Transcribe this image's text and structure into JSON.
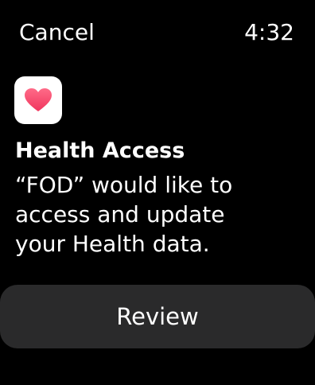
{
  "header": {
    "cancel_label": "Cancel",
    "time": "4:32"
  },
  "icon": {
    "name": "health-heart-icon",
    "heart_color": "#f4486b",
    "background": "#ffffff"
  },
  "dialog": {
    "title": "Health Access",
    "message_lines": [
      "“FOD” would like to",
      "access and update",
      "your Health data."
    ]
  },
  "actions": {
    "review_label": "Review"
  }
}
